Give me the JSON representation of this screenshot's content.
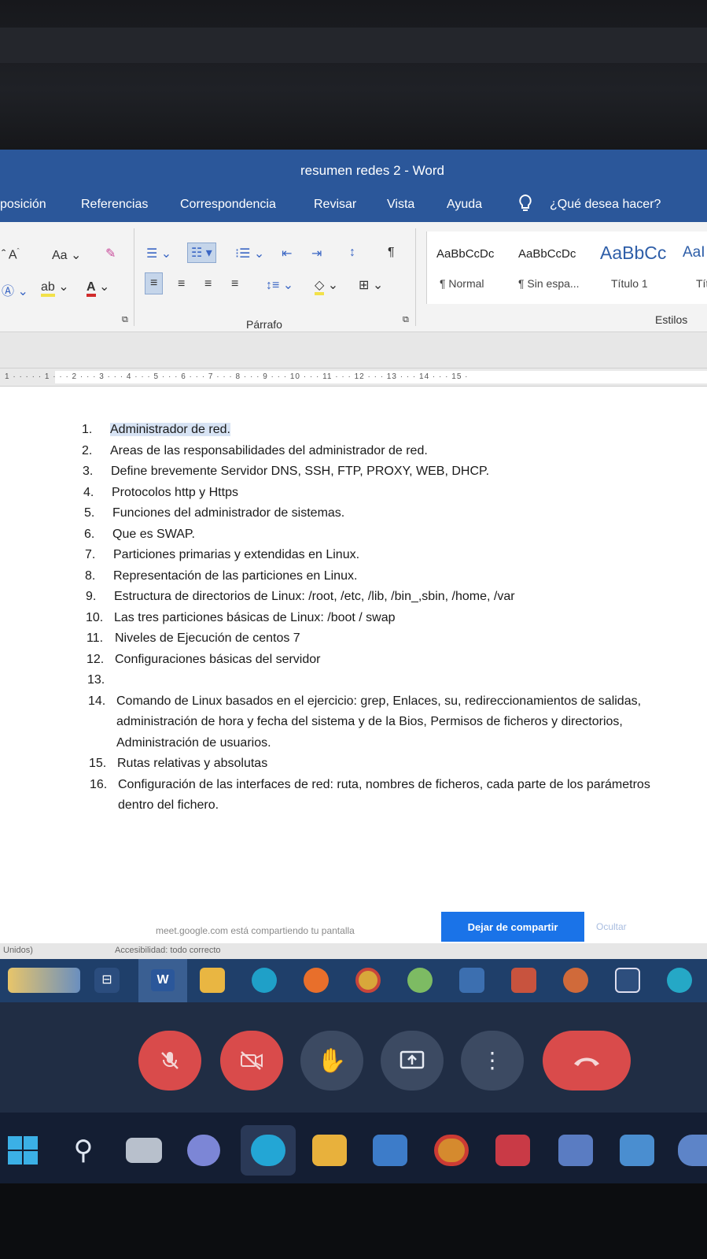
{
  "window": {
    "title": "resumen redes 2 - Word"
  },
  "menu": {
    "items": [
      "posición",
      "Referencias",
      "Correspondencia",
      "Revisar",
      "Vista",
      "Ayuda"
    ],
    "tell_me": "¿Qué desea hacer?"
  },
  "ribbon": {
    "paragraph_group": "Párrafo",
    "styles_group": "Estilos",
    "font_size_btn": "Aa",
    "styles": [
      {
        "preview": "AaBbCcDc",
        "name": "¶ Normal"
      },
      {
        "preview": "AaBbCcDc",
        "name": "¶ Sin espa..."
      },
      {
        "preview": "AaBbCc",
        "name": "Título 1"
      },
      {
        "preview": "AaI",
        "name": "Tít"
      }
    ]
  },
  "ruler": {
    "numbers": "1 · · · · · 1 · · · 2 · · · 3 · · · 4 · · · 5 · · · 6 · · · 7 · · · 8 · · · 9 · · · 10 · · · 11 · · · 12 · · · 13 · · · 14 · · · 15 ·"
  },
  "document": {
    "items": [
      {
        "n": "1.",
        "t": "Administrador de red."
      },
      {
        "n": "2.",
        "t": "Areas de las responsabilidades del administrador de red."
      },
      {
        "n": "3.",
        "t": "Define brevemente Servidor DNS, SSH, FTP, PROXY, WEB, DHCP."
      },
      {
        "n": "4.",
        "t": "Protocolos http y Https"
      },
      {
        "n": "5.",
        "t": "Funciones del administrador de sistemas."
      },
      {
        "n": "6.",
        "t": "Que es SWAP."
      },
      {
        "n": "7.",
        "t": "Particiones primarias y extendidas en Linux."
      },
      {
        "n": "8.",
        "t": "Representación de las particiones en Linux."
      },
      {
        "n": "9.",
        "t": "Estructura de directorios de Linux: /root, /etc, /lib, /bin_,sbin, /home, /var"
      },
      {
        "n": "10.",
        "t": "Las tres particiones básicas de Linux: /boot   /   swap"
      },
      {
        "n": "11.",
        "t": "Niveles de Ejecución de centos 7"
      },
      {
        "n": "12.",
        "t": "Configuraciones básicas del servidor"
      },
      {
        "n": "13.",
        "t": ""
      },
      {
        "n": "14.",
        "t": "Comando de Linux basados en el ejercicio: grep, Enlaces, su, redireccionamientos de salidas, administración de hora y fecha del sistema y de la Bios, Permisos de ficheros y directorios, Administración de usuarios."
      },
      {
        "n": "15.",
        "t": "Rutas relativas y absolutas"
      },
      {
        "n": "16.",
        "t": "Configuración de las interfaces de red: ruta, nombres de ficheros, cada parte de los parámetros dentro del fichero."
      }
    ]
  },
  "share": {
    "text": "meet.google.com está compartiendo tu pantalla",
    "stop_button": "Dejar de compartir",
    "hide": "Ocultar"
  },
  "status": {
    "language": "Unidos)",
    "accessibility": "Accesibilidad: todo correcto"
  },
  "colors": {
    "word_blue": "#2b579a",
    "meet_red": "#d94b4b",
    "meet_bg": "#202d44",
    "share_blue": "#1a73e8"
  }
}
